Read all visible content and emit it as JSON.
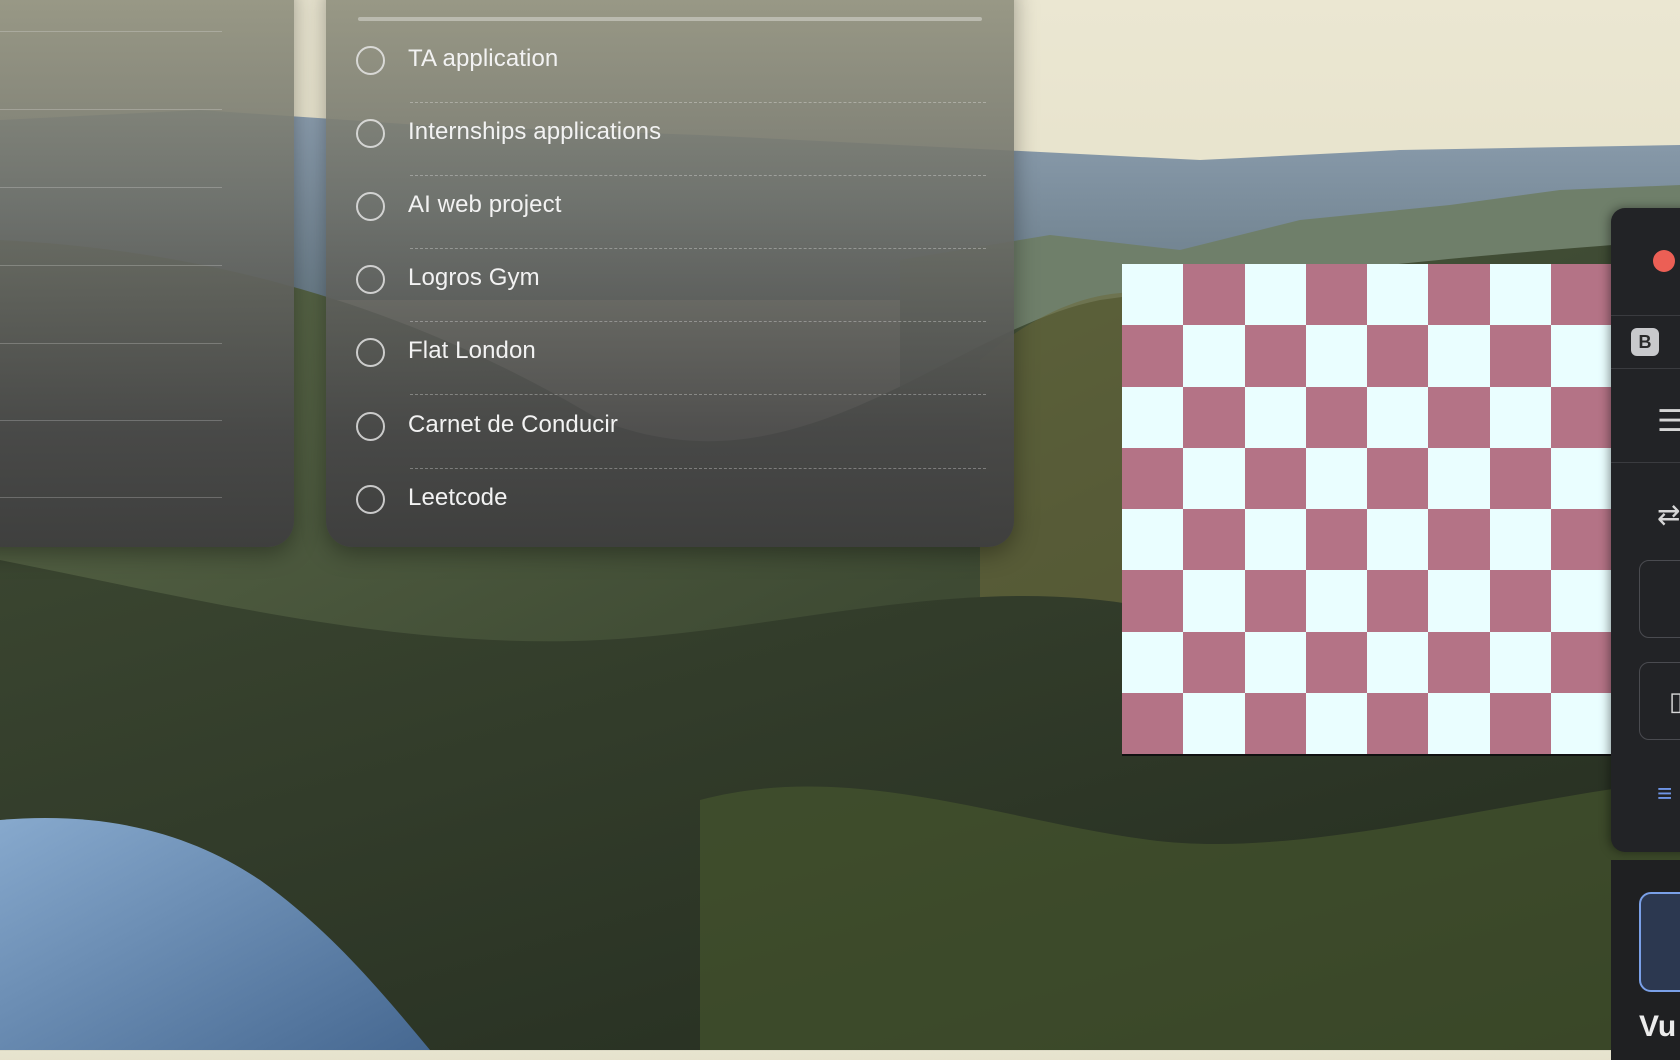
{
  "tasks": [
    {
      "label": "TA application"
    },
    {
      "label": "Internships applications"
    },
    {
      "label": "AI web project"
    },
    {
      "label": "Logros Gym"
    },
    {
      "label": "Flat London"
    },
    {
      "label": "Carnet de Conducir"
    },
    {
      "label": "Leetcode"
    }
  ],
  "checkerboard": {
    "light_color": "#eafeff",
    "dark_color": "#b47386",
    "rows": 8,
    "cols": 8
  },
  "app_window": {
    "badge": "B",
    "partial_text": "Vu",
    "icons": [
      "close-button",
      "menu-icon",
      "swap-icon",
      "calendar-icon",
      "filter-icon"
    ]
  },
  "colors": {
    "accent": "#7aa0e8",
    "close_red": "#ec5f55"
  }
}
